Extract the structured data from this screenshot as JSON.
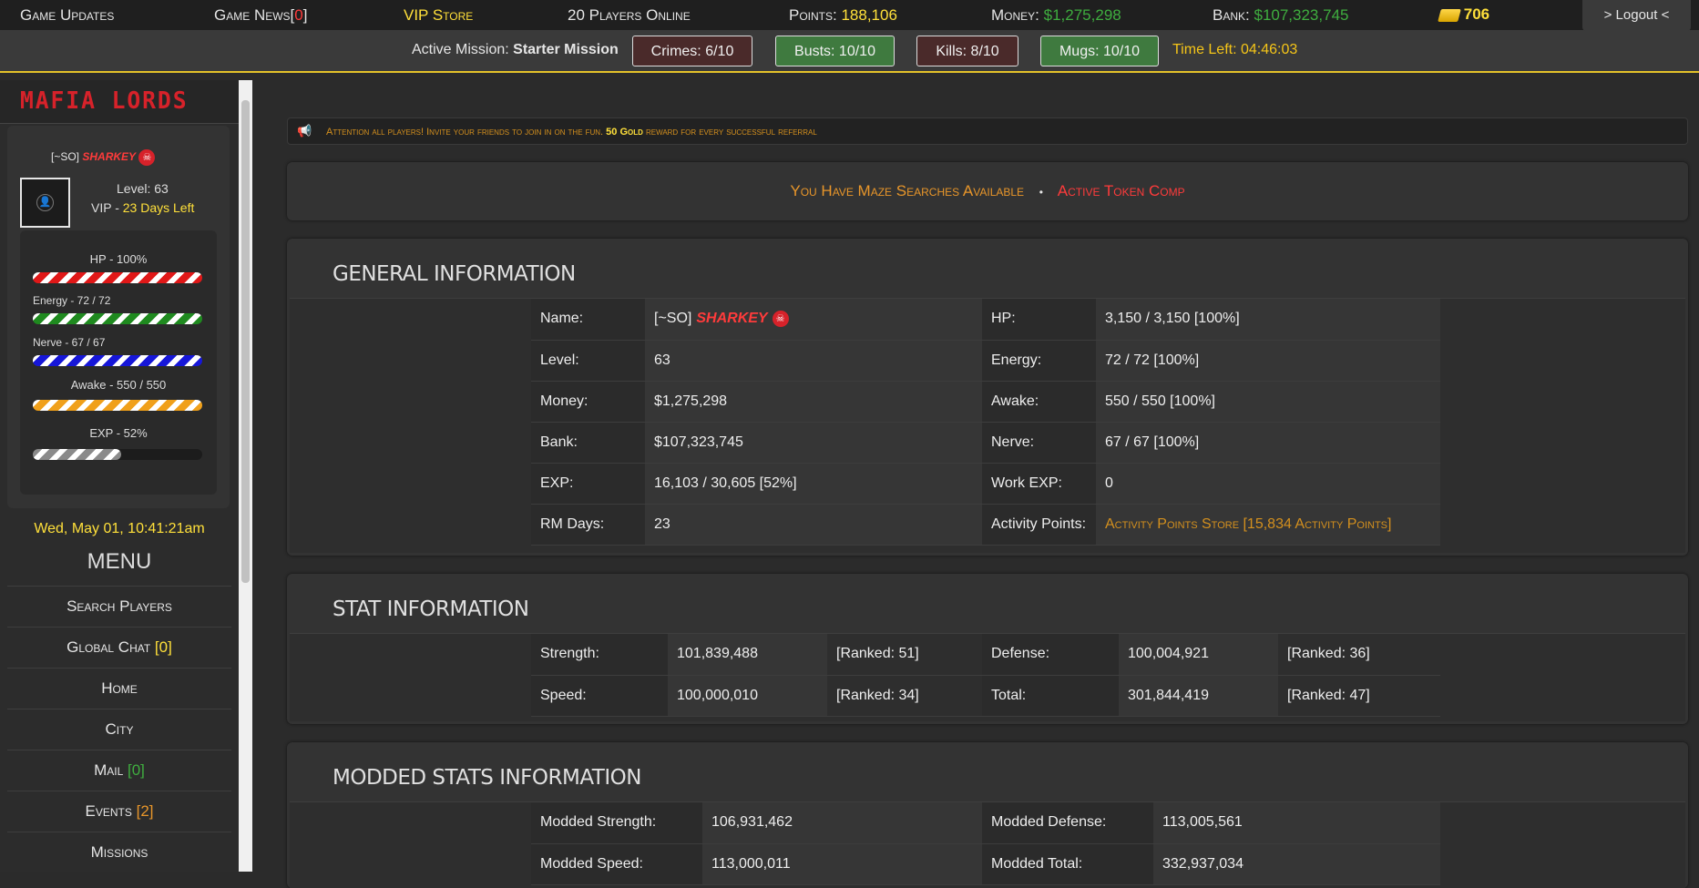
{
  "topbar": {
    "game_updates": "Game Updates",
    "game_news_label": "Game News[",
    "game_news_count": "0",
    "game_news_close": "]",
    "vip_store": "VIP Store",
    "players_online": "20 Players Online",
    "points_label": "Points:",
    "points_value": "188,106",
    "money_label": "Money:",
    "money_value": "$1,275,298",
    "bank_label": "Bank:",
    "bank_value": "$107,323,745",
    "gold_value": "706",
    "logout": "> Logout <"
  },
  "mission": {
    "label": "Active Mission:",
    "name": "Starter Mission",
    "crimes": "Crimes: 6/10",
    "busts": "Busts: 10/10",
    "kills": "Kills: 8/10",
    "mugs": "Mugs: 10/10",
    "time_left": "Time Left: 04:46:03"
  },
  "sidebar": {
    "logo": "MAFIA LORDS",
    "profile": {
      "gang_tag": "[~SO]",
      "name": "SHARKEY",
      "level": "Level: 63",
      "vip_label": "VIP -",
      "vip_value": "23 Days Left"
    },
    "bars": {
      "hp": "HP - 100%",
      "energy": "Energy - 72 / 72",
      "nerve": "Nerve - 67 / 67",
      "awake": "Awake - 550 / 550",
      "exp": "EXP - 52%",
      "exp_fraction": 0.52
    },
    "datetime": "Wed, May 01, 10:41:21am",
    "menu_title": "MENU",
    "menu": {
      "search_players": "Search Players",
      "global_chat": "Global Chat",
      "global_chat_count": "[0]",
      "home": "Home",
      "city": "City",
      "mail": "Mail",
      "mail_count": "[0]",
      "events": "Events",
      "events_count": "[2]",
      "missions": "Missions"
    }
  },
  "attention": {
    "text_before": "Attention all players! Invite your friends to join in on the fun.",
    "reward": "50 Gold",
    "text_after": "reward for every successful referral"
  },
  "notice": {
    "maze": "You Have Maze Searches Available",
    "separator": "•",
    "token": "Active Token Comp"
  },
  "general": {
    "title": "GENERAL INFORMATION",
    "rows": [
      {
        "k1": "Name:",
        "v1": "[~SO]",
        "k2": "HP:",
        "v2": "3,150 / 3,150 [100%]"
      },
      {
        "k1": "Level:",
        "v1": "63",
        "k2": "Energy:",
        "v2": "72 / 72 [100%]"
      },
      {
        "k1": "Money:",
        "v1": "$1,275,298",
        "k2": "Awake:",
        "v2": "550 / 550 [100%]"
      },
      {
        "k1": "Bank:",
        "v1": "$107,323,745",
        "k2": "Nerve:",
        "v2": "67 / 67 [100%]"
      },
      {
        "k1": "EXP:",
        "v1": "16,103 / 30,605 [52%]",
        "k2": "Work EXP:",
        "v2": "0"
      },
      {
        "k1": "RM Days:",
        "v1": "23",
        "k2": "Activity Points:",
        "v2": "Activity Points Store [15,834 Activity Points]"
      }
    ],
    "name_player": "SHARKEY"
  },
  "stats": {
    "title": "STAT INFORMATION",
    "rows": [
      {
        "k1": "Strength:",
        "v1": "101,839,488",
        "r1": "[Ranked: 51]",
        "k2": "Defense:",
        "v2": "100,004,921",
        "r2": "[Ranked: 36]"
      },
      {
        "k1": "Speed:",
        "v1": "100,000,010",
        "r1": "[Ranked: 34]",
        "k2": "Total:",
        "v2": "301,844,419",
        "r2": "[Ranked: 47]"
      }
    ]
  },
  "modded": {
    "title": "MODDED STATS INFORMATION",
    "rows": [
      {
        "k1": "Modded Strength:",
        "v1": "106,931,462",
        "k2": "Modded Defense:",
        "v2": "113,005,561"
      },
      {
        "k1": "Modded Speed:",
        "v1": "113,000,011",
        "k2": "Modded Total:",
        "v2": "332,937,034"
      }
    ]
  }
}
